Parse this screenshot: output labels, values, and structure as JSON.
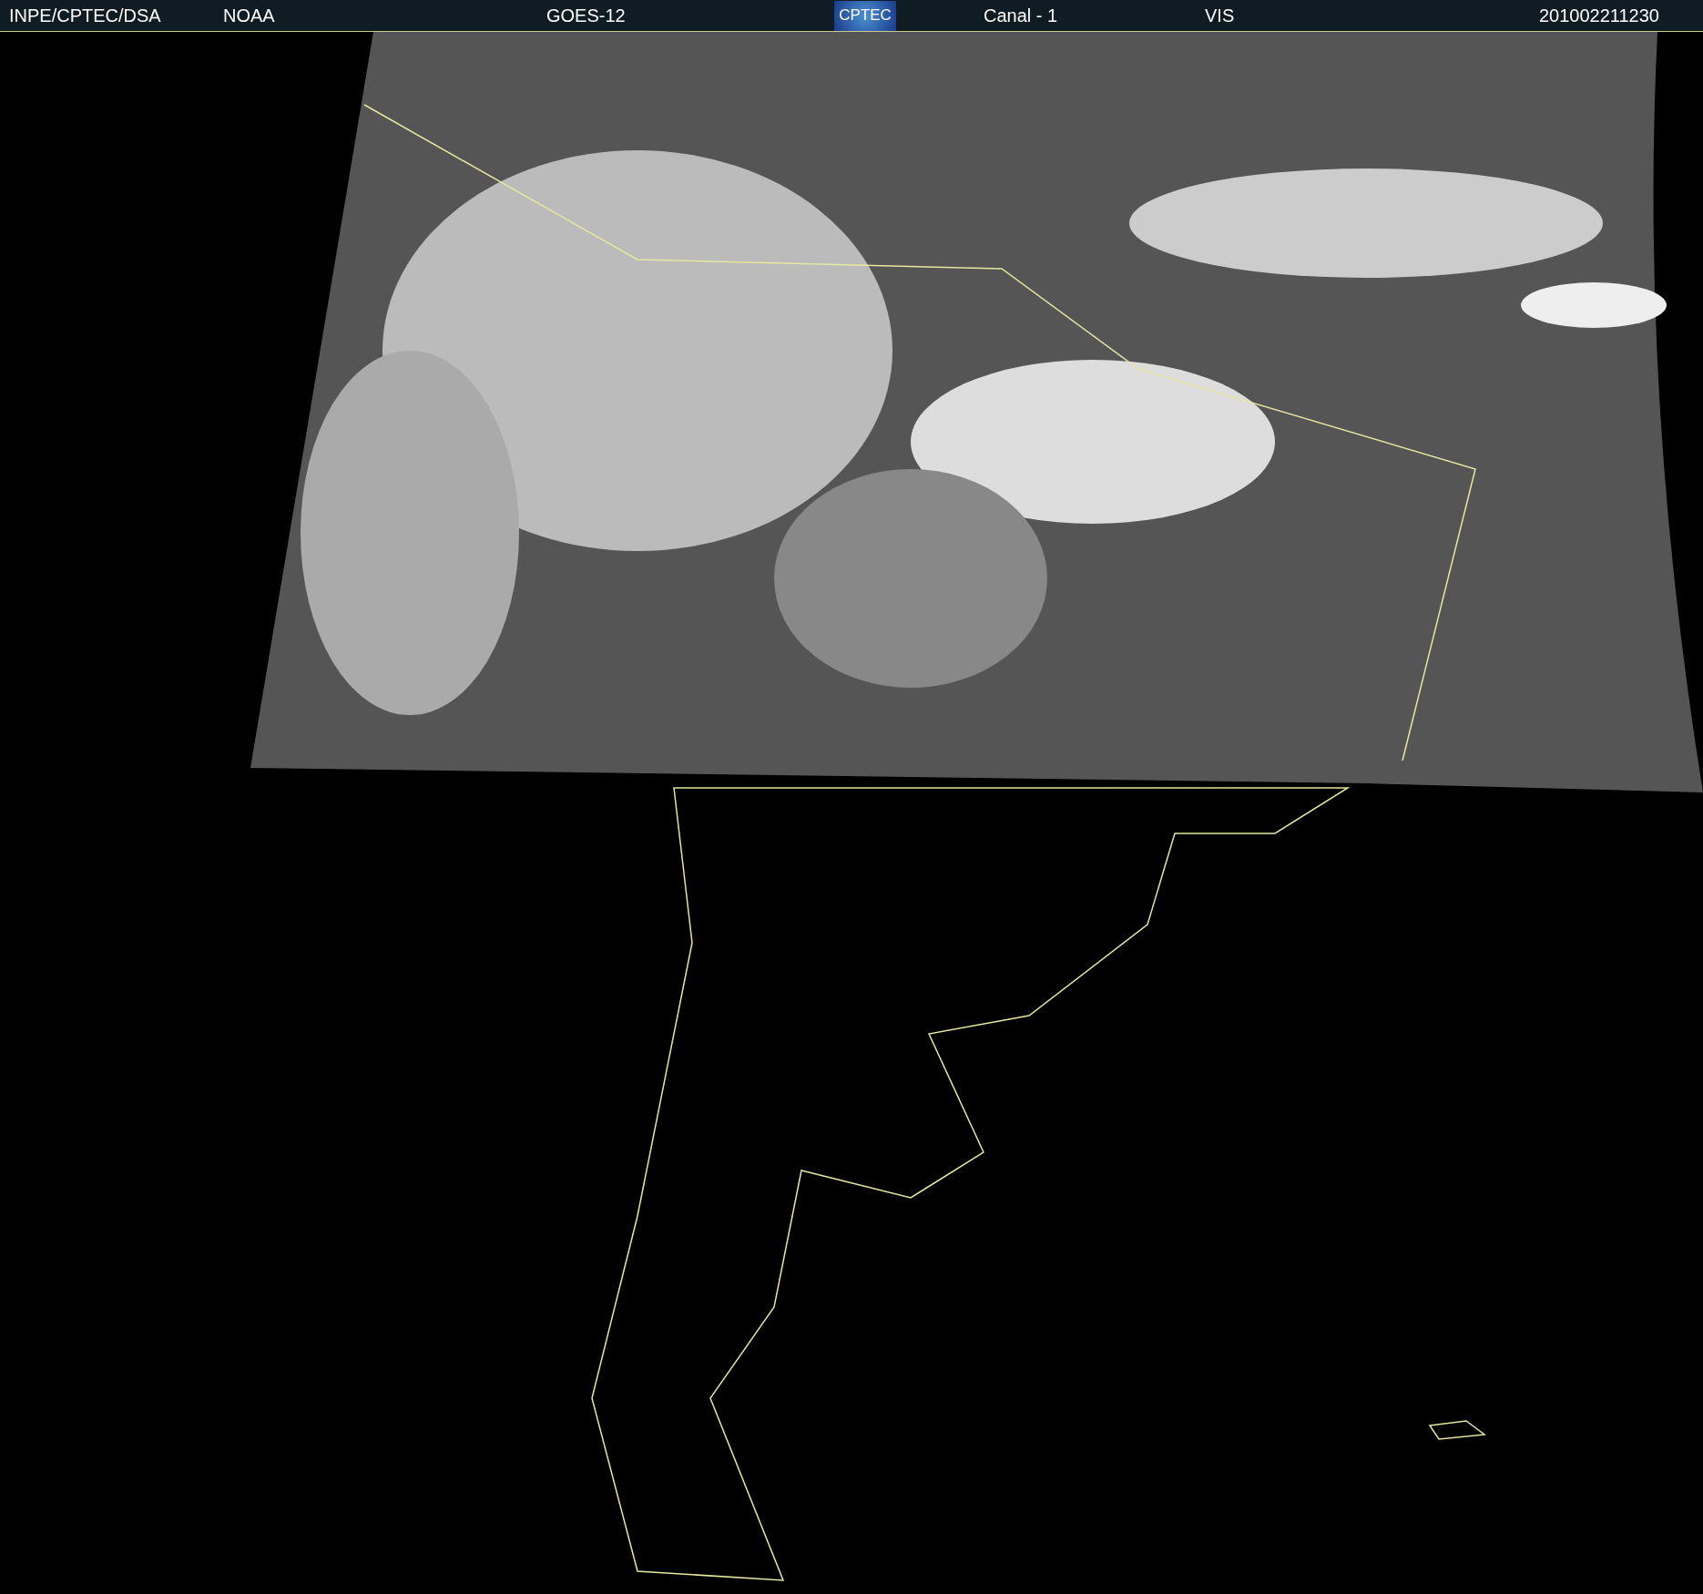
{
  "header": {
    "source": "INPE/CPTEC/DSA",
    "agency": "NOAA",
    "satellite": "GOES-12",
    "logo": "CPTEC",
    "channel": "Canal - 1",
    "band": "VIS",
    "timestamp": "201002211230"
  }
}
